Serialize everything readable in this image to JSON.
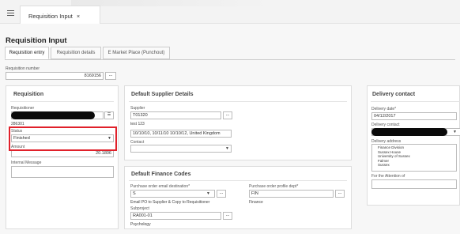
{
  "header": {
    "tab_label": "Requisition Input",
    "tab_close": "×"
  },
  "page": {
    "title": "Requisition Input"
  },
  "tabs": [
    {
      "label": "Requisition entry",
      "active": true
    },
    {
      "label": "Requisition details",
      "active": false
    },
    {
      "label": "E Market Place (Punchout)",
      "active": false
    }
  ],
  "requisition_number": {
    "label": "Requisition number",
    "value": "8169156"
  },
  "requisition_panel": {
    "title": "Requisition",
    "requisitioner_label": "Requisitioner",
    "requisitioner_code": "286301",
    "status_label": "Status",
    "status_value": "Finished",
    "amount_label": "Amount",
    "amount_value": "20.1806",
    "internal_message_label": "Internal Message"
  },
  "supplier_panel": {
    "title": "Default Supplier Details",
    "supplier_label": "Supplier",
    "supplier_value": "T01320",
    "supplier_name": "test 123",
    "address_value": "10/10/10, 10/11/10 10/10/12, United Kingdom",
    "contact_label": "Contact"
  },
  "finance_panel": {
    "title": "Default Finance Codes",
    "email_dest_label": "Purchase order email destination*",
    "email_dest_value": "S",
    "email_dest_note": "Email PO to Supplier & Copy to Requisitioner",
    "profile_dept_label": "Purchase order profile dept*",
    "profile_dept_value": "FIN",
    "profile_dept_name": "Finance",
    "subproject_label": "Subproject",
    "subproject_value": "RA001-01",
    "subproject_name": "Psychology"
  },
  "delivery_panel": {
    "title": "Delivery contact",
    "date_label": "Delivery date*",
    "date_value": "04/12/2017",
    "contact_label": "Delivery contact",
    "address_label": "Delivery address",
    "address_lines": [
      "Finance Division",
      "Sussex House",
      "University of Sussex",
      "Falmer",
      "Sussex"
    ],
    "attention_label": "For the Attention of"
  },
  "glyphs": {
    "dots": "...",
    "caret": "▼",
    "table_icon": "☰"
  },
  "colors": {
    "highlight": "#e0202a",
    "background": "#f7f7f7",
    "panel": "#ffffff"
  }
}
